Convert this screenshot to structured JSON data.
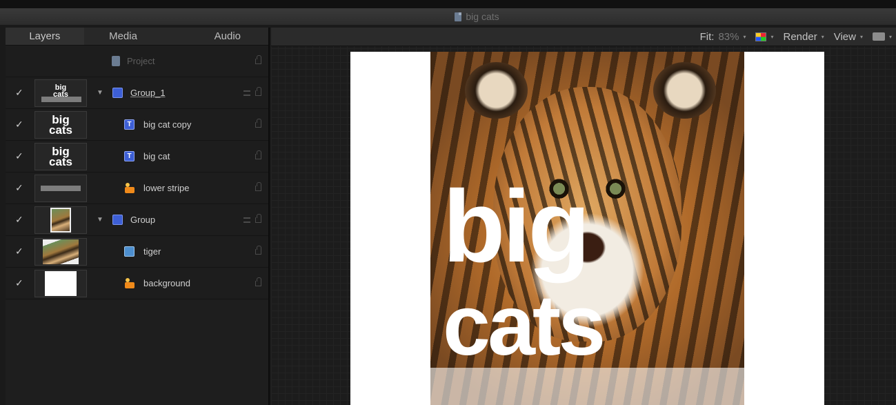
{
  "window": {
    "title": "big cats",
    "title_icon": "document-icon"
  },
  "left_panel": {
    "tabs": [
      {
        "label": "Layers",
        "active": true
      },
      {
        "label": "Media",
        "active": false
      },
      {
        "label": "Audio",
        "active": false
      }
    ],
    "project_label": "Project",
    "layers": [
      {
        "name": "Group_1",
        "checked": "✓",
        "type": "group",
        "thumb": "big cats"
      },
      {
        "name": "big cat copy",
        "checked": "✓",
        "type": "text",
        "thumb": "big cats"
      },
      {
        "name": "big cat",
        "checked": "✓",
        "type": "text",
        "thumb": "big cats"
      },
      {
        "name": "lower stripe",
        "checked": "✓",
        "type": "shape",
        "thumb": ""
      },
      {
        "name": "Group",
        "checked": "✓",
        "type": "group",
        "thumb": ""
      },
      {
        "name": "tiger",
        "checked": "✓",
        "type": "image",
        "thumb": ""
      },
      {
        "name": "background",
        "checked": "✓",
        "type": "shape",
        "thumb": ""
      }
    ],
    "thumb_text_line1": "big",
    "thumb_text_line2": "cats"
  },
  "toolbar": {
    "fit_label": "Fit:",
    "fit_value": "83%",
    "render_label": "Render",
    "view_label": "View",
    "caret": "▾"
  },
  "canvas": {
    "text_line1": "big",
    "text_line2": "cats",
    "background_color": "#ffffff",
    "text_color": "#ffffff"
  },
  "icons": {
    "check": "✓",
    "disclosure_open": "▼",
    "text_layer_glyph": "T"
  }
}
